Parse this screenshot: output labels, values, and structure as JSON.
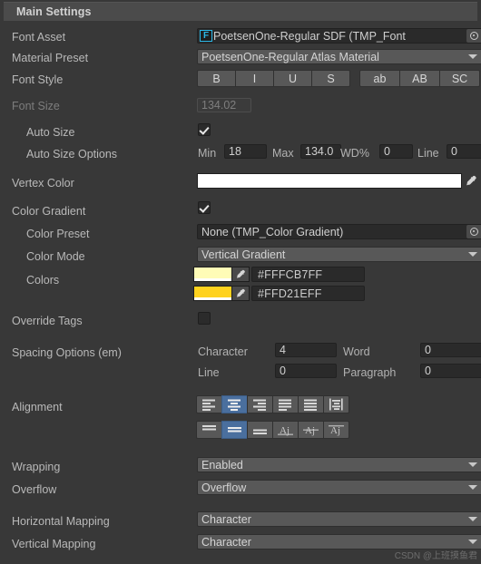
{
  "header": {
    "title": "Main Settings"
  },
  "rows": {
    "font_asset": {
      "label": "Font Asset",
      "icon_letter": "F",
      "value": "PoetsenOne-Regular SDF (TMP_Font",
      "picker_icon": "object-picker-icon"
    },
    "material_preset": {
      "label": "Material Preset",
      "value": "PoetsenOne-Regular Atlas Material"
    },
    "font_style": {
      "label": "Font Style",
      "group_a": [
        {
          "label": "B",
          "name": "bold",
          "on": false
        },
        {
          "label": "I",
          "name": "italic",
          "on": false
        },
        {
          "label": "U",
          "name": "underline",
          "on": false
        },
        {
          "label": "S",
          "name": "strikethrough",
          "on": false
        }
      ],
      "group_b": [
        {
          "label": "ab",
          "name": "lowercase",
          "on": false
        },
        {
          "label": "AB",
          "name": "uppercase",
          "on": false
        },
        {
          "label": "SC",
          "name": "smallcaps",
          "on": false
        }
      ]
    },
    "font_size": {
      "label": "Font Size",
      "value": "134.02",
      "disabled": true
    },
    "auto_size": {
      "label": "Auto Size",
      "checked": true
    },
    "auto_size_options": {
      "label": "Auto Size Options",
      "fields": [
        {
          "label": "Min",
          "value": "18"
        },
        {
          "label": "Max",
          "value": "134.0"
        },
        {
          "label": "WD%",
          "value": "0"
        },
        {
          "label": "Line",
          "value": "0"
        }
      ]
    },
    "vertex_color": {
      "label": "Vertex Color",
      "color": "#FFFFFF",
      "eyedropper_icon": "eyedropper-icon"
    },
    "color_gradient": {
      "label": "Color Gradient",
      "checked": true
    },
    "color_preset": {
      "label": "Color Preset",
      "value": "None (TMP_Color Gradient)"
    },
    "color_mode": {
      "label": "Color Mode",
      "value": "Vertical Gradient"
    },
    "colors": {
      "label": "Colors",
      "entries": [
        {
          "swatch": "#FFFCB7",
          "hex": "#FFFCB7FF"
        },
        {
          "swatch": "#FFD21E",
          "hex": "#FFD21EFF"
        }
      ]
    },
    "override_tags": {
      "label": "Override Tags",
      "checked": false
    },
    "spacing_options": {
      "label": "Spacing Options (em)",
      "fields": [
        {
          "label": "Character",
          "value": "4"
        },
        {
          "label": "Word",
          "value": "0"
        },
        {
          "label": "Line",
          "value": "0"
        },
        {
          "label": "Paragraph",
          "value": "0"
        }
      ]
    },
    "alignment": {
      "label": "Alignment",
      "horizontal": [
        {
          "name": "align-left",
          "on": false
        },
        {
          "name": "align-center",
          "on": true
        },
        {
          "name": "align-right",
          "on": false
        },
        {
          "name": "align-justified",
          "on": false
        },
        {
          "name": "align-flush",
          "on": false
        },
        {
          "name": "align-geometry-center",
          "on": false
        }
      ],
      "vertical": [
        {
          "name": "align-top",
          "on": false
        },
        {
          "name": "align-middle",
          "on": true
        },
        {
          "name": "align-bottom",
          "on": false
        },
        {
          "name": "align-baseline",
          "on": false
        },
        {
          "name": "align-midline",
          "on": false
        },
        {
          "name": "align-capline",
          "on": false
        }
      ]
    },
    "wrapping": {
      "label": "Wrapping",
      "value": "Enabled"
    },
    "overflow": {
      "label": "Overflow",
      "value": "Overflow"
    },
    "horizontal_mapping": {
      "label": "Horizontal Mapping",
      "value": "Character"
    },
    "vertical_mapping": {
      "label": "Vertical Mapping",
      "value": "Character"
    }
  },
  "watermark": {
    "text": "CSDN @上班摸鱼君"
  }
}
